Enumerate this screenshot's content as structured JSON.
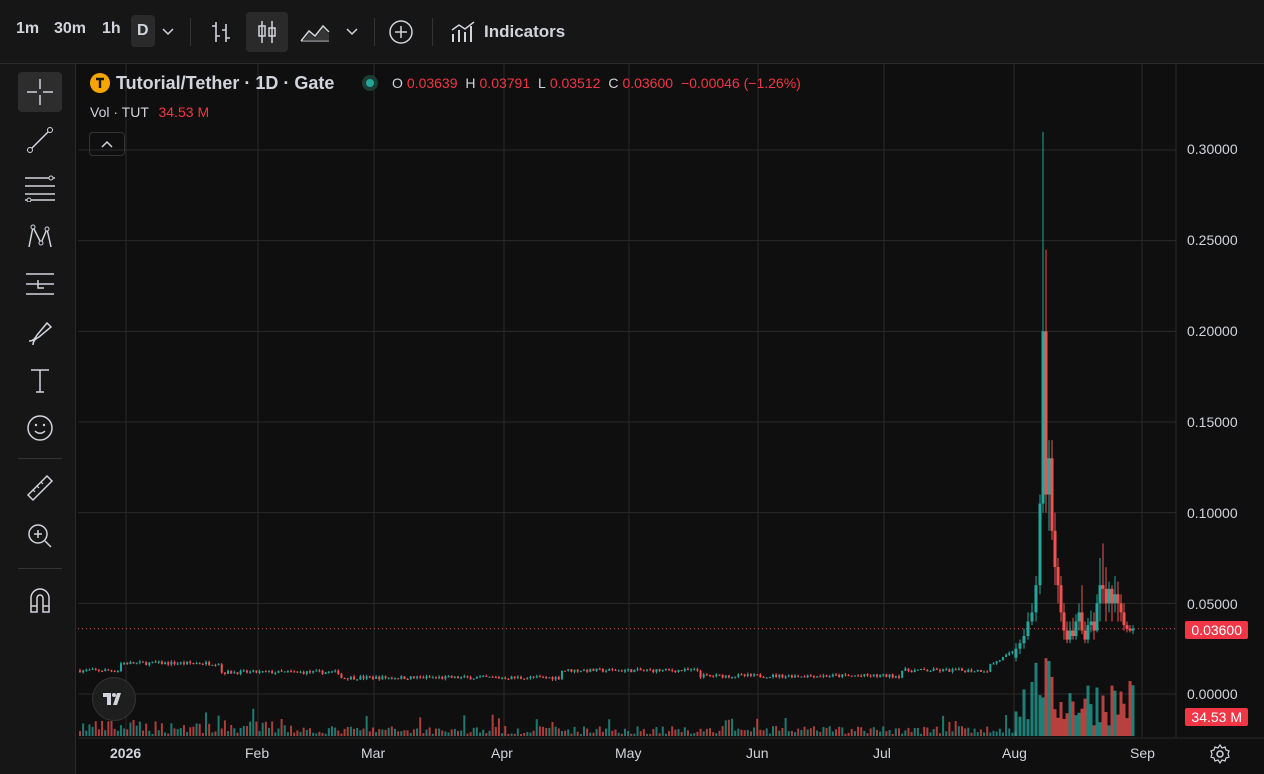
{
  "toolbar_top": {
    "timeframes": [
      "1m",
      "30m",
      "1h",
      "D"
    ],
    "active_timeframe": "D",
    "indicators_label": "Indicators"
  },
  "side_tools": [
    "crosshair-icon",
    "trend-line-icon",
    "fib-icon",
    "pattern-icon",
    "forecast-icon",
    "brush-icon",
    "text-icon",
    "emoji-icon",
    "ruler-icon",
    "zoom-in-icon",
    "magnet-icon"
  ],
  "legend": {
    "title": "Tutorial/Tether · 1D · Gate",
    "o_label": "O",
    "o": "0.03639",
    "h_label": "H",
    "h": "0.03791",
    "l_label": "L",
    "l": "0.03512",
    "c_label": "C",
    "c": "0.03600",
    "change": "−0.00046 (−1.26%)",
    "vol_label": "Vol · TUT",
    "vol_value": "34.53 M"
  },
  "price_axis": [
    "0.30000",
    "0.25000",
    "0.20000",
    "0.15000",
    "0.10000",
    "0.05000",
    "0.00000"
  ],
  "last_price": "0.03600",
  "last_volume": "34.53 M",
  "time_axis": [
    "2026",
    "Feb",
    "Mar",
    "Apr",
    "May",
    "Jun",
    "Jul",
    "Aug",
    "Sep"
  ],
  "colors": {
    "up": "#26a69a",
    "down": "#ef5350",
    "grid": "#2a2a2a"
  },
  "chart_data": {
    "type": "candlestick",
    "title": "Tutorial/Tether · 1D · Gate",
    "ylim": [
      0,
      0.32
    ],
    "x_ticks": [
      "2026",
      "Feb",
      "Mar",
      "Apr",
      "May",
      "Jun",
      "Jul",
      "Aug",
      "Sep"
    ],
    "ohlc_last": {
      "open": 0.03639,
      "high": 0.03791,
      "low": 0.03512,
      "close": 0.036
    },
    "spike_points": [
      {
        "period": "Aug",
        "high": 0.31,
        "low": 0.035
      },
      {
        "period": "Aug",
        "high": 0.245,
        "low": 0.05
      },
      {
        "period": "late-Aug",
        "high": 0.083,
        "low": 0.03
      }
    ],
    "baseline_price": 0.013,
    "last_volume": "34.53 M"
  }
}
